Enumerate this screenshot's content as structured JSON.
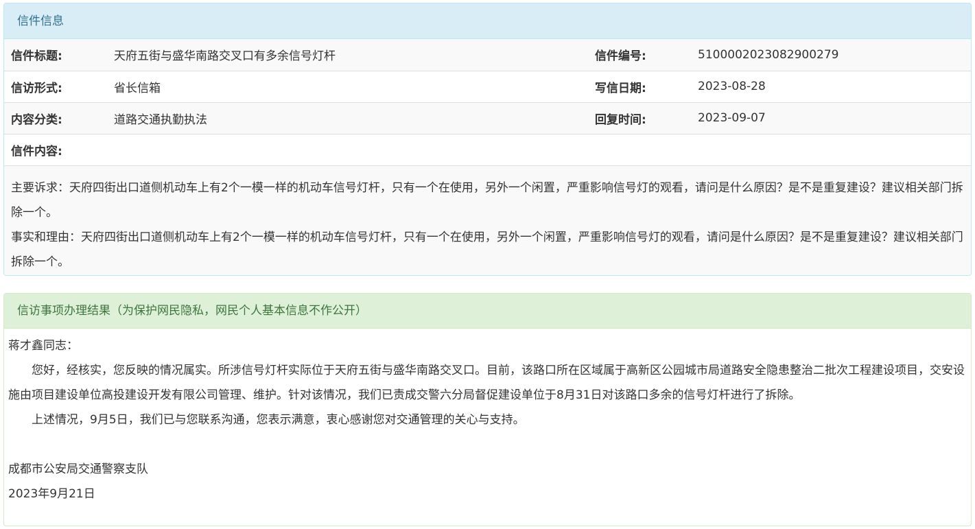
{
  "letter_info": {
    "heading": "信件信息",
    "rows": [
      {
        "label1": "信件标题:",
        "value1": "天府五街与盛华南路交叉口有多余信号灯杆",
        "label2": "信件编号:",
        "value2": "510000202308290027 9"
      },
      {
        "label1": "信访形式:",
        "value1": "省长信箱",
        "label2": "写信日期:",
        "value2": "2023-08-28"
      },
      {
        "label1": "内容分类:",
        "value1": "道路交通执勤执法",
        "label2": "回复时间:",
        "value2": "2023-09-07"
      }
    ],
    "content_label": "信件内容:",
    "content_paragraphs": [
      "主要诉求：天府四街出口道侧机动车上有2个一模一样的机动车信号灯杆，只有一个在使用，另外一个闲置，严重影响信号灯的观看，请问是什么原因？是不是重复建设？建议相关部门拆除一个。",
      "事实和理由：天府四街出口道侧机动车上有2个一模一样的机动车信号灯杆，只有一个在使用，另外一个闲置，严重影响信号灯的观看，请问是什么原因？是不是重复建设？建议相关部门拆除一个。"
    ]
  },
  "result": {
    "heading": "信访事项办理结果（为保护网民隐私，网民个人基本信息不作公开）",
    "salutation": "蒋才鑫同志：",
    "paragraphs": [
      "您好，经核实，您反映的情况属实。所涉信号灯杆实际位于天府五街与盛华南路交叉口。目前，该路口所在区域属于高新区公园城市局道路安全隐患整治二批次工程建设项目，交安设施由项目建设单位高投建设开发有限公司管理、维护。针对该情况，我们已责成交警六分局督促建设单位于8月31日对该路口多余的信号灯杆进行了拆除。",
      "上述情况，9月5日，我们已与您联系沟通，您表示满意，衷心感谢您对交通管理的关心与支持。"
    ],
    "signature_org": "成都市公安局交通警察支队",
    "signature_date": "2023年9月21日"
  }
}
